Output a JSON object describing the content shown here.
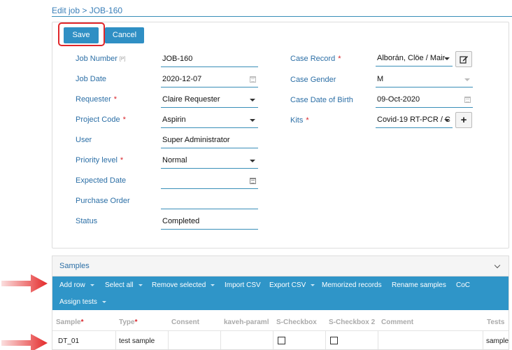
{
  "breadcrumb": "Edit job > JOB-160",
  "toolbar": {
    "save_label": "Save",
    "cancel_label": "Cancel"
  },
  "left_fields": [
    {
      "label": "Job Number",
      "required": false,
      "pinned": true,
      "pin_text": "[P]",
      "value": "JOB-160",
      "control": "text"
    },
    {
      "label": "Job Date",
      "required": false,
      "value": "2020-12-07",
      "control": "date"
    },
    {
      "label": "Requester",
      "required": true,
      "value": "Claire Requester",
      "control": "select"
    },
    {
      "label": "Project Code",
      "required": true,
      "value": "Aspirin",
      "control": "select"
    },
    {
      "label": "User",
      "required": false,
      "value": "Super Administrator",
      "control": "text"
    },
    {
      "label": "Priority level",
      "required": true,
      "value": "Normal",
      "control": "select"
    },
    {
      "label": "Expected Date",
      "required": false,
      "value": "",
      "control": "date"
    },
    {
      "label": "Purchase Order",
      "required": false,
      "value": "",
      "control": "text"
    },
    {
      "label": "Status",
      "required": false,
      "value": "Completed",
      "control": "text"
    }
  ],
  "right_fields": [
    {
      "label": "Case Record",
      "required": true,
      "value": "Alborán, Clöe / Mair",
      "control": "select",
      "action_icon": "edit-icon"
    },
    {
      "label": "Case Gender",
      "required": false,
      "value": "M",
      "control": "select-disabled"
    },
    {
      "label": "Case Date of Birth",
      "required": false,
      "value": "09-Oct-2020",
      "control": "date-disabled"
    },
    {
      "label": "Kits",
      "required": true,
      "value": "Covid-19 RT-PCR / C",
      "control": "select",
      "action_icon": "plus-icon"
    }
  ],
  "required_marker": "*",
  "samples": {
    "title": "Samples",
    "toolbar_items": [
      {
        "label": "Add row",
        "dropdown": true
      },
      {
        "label": "Select all",
        "dropdown": true
      },
      {
        "label": "Remove selected",
        "dropdown": true
      },
      {
        "label": "Import CSV",
        "dropdown": false
      },
      {
        "label": "Export CSV",
        "dropdown": true
      },
      {
        "label": "Memorized records",
        "dropdown": false
      },
      {
        "label": "Rename samples",
        "dropdown": false
      },
      {
        "label": "CoC",
        "dropdown": false
      },
      {
        "label": "Assign tests",
        "dropdown": true
      }
    ],
    "columns": [
      {
        "label": "Sample",
        "required": true
      },
      {
        "label": "Type",
        "required": true
      },
      {
        "label": "Consent",
        "required": false
      },
      {
        "label": "kaveh-paraml",
        "required": false
      },
      {
        "label": "S-Checkbox",
        "required": false
      },
      {
        "label": "S-Checkbox 2",
        "required": false
      },
      {
        "label": "Comment",
        "required": false
      },
      {
        "label": "Tests",
        "required": false
      }
    ],
    "rows": [
      {
        "sample": "DT_01",
        "type": "test sample",
        "consent": "",
        "kaveh_paraml": "",
        "s_checkbox": false,
        "s_checkbox_2": false,
        "comment": "",
        "tests": "sample"
      }
    ]
  },
  "colors": {
    "accent": "#2f95c8",
    "label": "#2c6fa6",
    "required": "#d9232a",
    "highlight": "#e0262a"
  }
}
